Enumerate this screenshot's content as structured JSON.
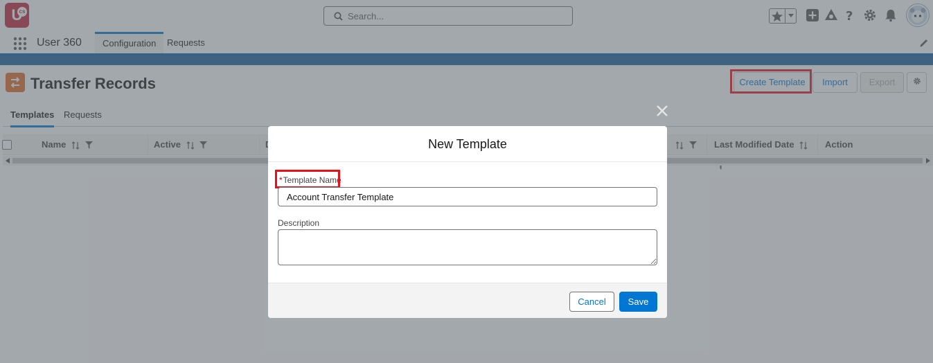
{
  "header": {
    "logo_text": "U",
    "logo_sub": "cs",
    "search_placeholder": "Search..."
  },
  "nav": {
    "app_name": "User 360",
    "tabs": [
      {
        "label": "Configuration",
        "active": true
      },
      {
        "label": "Requests",
        "active": false
      }
    ]
  },
  "page": {
    "title": "Transfer Records",
    "buttons": {
      "create_template": "Create Template",
      "import": "Import",
      "export": "Export"
    },
    "tabs": [
      {
        "label": "Templates",
        "active": true
      },
      {
        "label": "Requests",
        "active": false
      }
    ],
    "table": {
      "columns": [
        "Name",
        "Active",
        "D",
        "Last Modified Date",
        "Action"
      ]
    }
  },
  "modal": {
    "title": "New Template",
    "template_name_label": "Template Name",
    "template_name_required": "*",
    "template_name_value": "Account Transfer Template",
    "description_label": "Description",
    "description_value": "",
    "cancel_label": "Cancel",
    "save_label": "Save"
  },
  "colors": {
    "brand": "#0176d3",
    "highlight": "#e8111b",
    "logo": "#c2243a",
    "page_icon": "#e26b26"
  }
}
